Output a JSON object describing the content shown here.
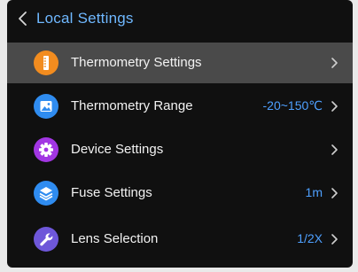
{
  "header": {
    "back_icon": "chevron-left-icon",
    "title": "Local Settings"
  },
  "colors": {
    "accent": "#4ea0ff",
    "title": "#6fb8ff",
    "selected_row": "#4a4a4a",
    "background": "#101010"
  },
  "menu": {
    "items": [
      {
        "label": "Thermometry Settings",
        "value": "",
        "icon": "thermometer-icon",
        "icon_color": "#f28c1f",
        "selected": true
      },
      {
        "label": "Thermometry Range",
        "value": "-20~150℃",
        "icon": "image-icon",
        "icon_color": "#2f8cf0",
        "selected": false
      },
      {
        "label": "Device Settings",
        "value": "",
        "icon": "gear-icon",
        "icon_color": "#a236e3",
        "selected": false
      },
      {
        "label": "Fuse Settings",
        "value": "1m",
        "icon": "layers-icon",
        "icon_color": "#2f8cf0",
        "selected": false
      },
      {
        "label": "Lens Selection",
        "value": "1/2X",
        "icon": "wrench-icon",
        "icon_color": "#6e57d9",
        "selected": false
      }
    ]
  }
}
